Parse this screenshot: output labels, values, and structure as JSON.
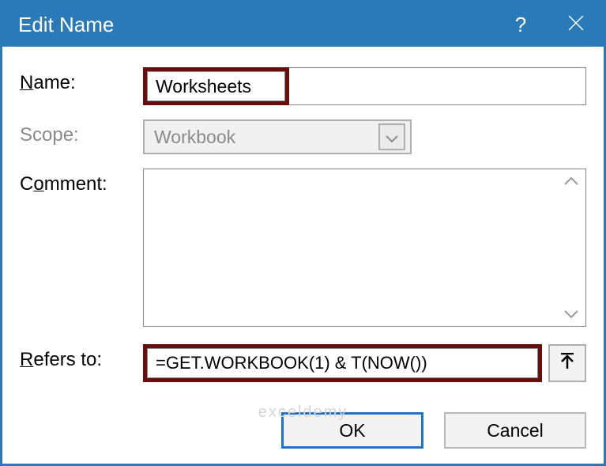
{
  "dialog": {
    "title": "Edit Name",
    "labels": {
      "name_prefix": "N",
      "name_rest": "ame:",
      "scope_prefix": "S",
      "scope_rest": "cope:",
      "comment_prefix": "C",
      "comment_mid": "o",
      "comment_rest": "mment:",
      "refers_prefix": "R",
      "refers_rest": "efers to:"
    },
    "fields": {
      "name_value": "Worksheets",
      "scope_value": "Workbook",
      "comment_value": "",
      "refers_value": "=GET.WORKBOOK(1) & T(NOW())"
    },
    "buttons": {
      "ok": "OK",
      "cancel": "Cancel"
    }
  },
  "icons": {
    "help": "?",
    "close": "close-icon",
    "chevron_down": "chevron-down-icon",
    "scroll_up": "scroll-up-icon",
    "scroll_down": "scroll-down-icon",
    "collapse_ref": "collapse-dialog-icon"
  },
  "colors": {
    "titlebar": "#2a7ab9",
    "highlight_border": "#6a0d0d",
    "ok_border": "#1f72c9"
  },
  "watermark": "exceldemy"
}
